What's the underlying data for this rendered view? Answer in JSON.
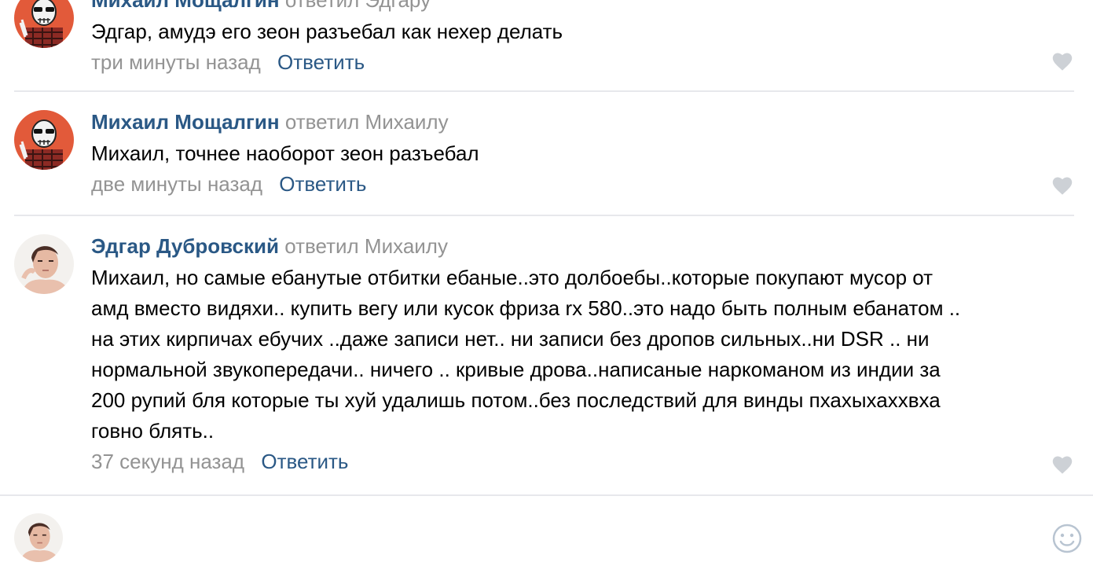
{
  "comments": [
    {
      "author": "Михаил Мощалгин",
      "replied": "ответил Эдгару",
      "text": "Эдгар, амудэ его зеон разъебал как нехер делать",
      "time": "три минуты назад",
      "reply_label": "Ответить"
    },
    {
      "author": "Михаил Мощалгин",
      "replied": "ответил Михаилу",
      "text": "Михаил, точнее наоборот зеон разъебал",
      "time": "две минуты назад",
      "reply_label": "Ответить"
    },
    {
      "author": "Эдгар Дубровский",
      "replied": "ответил Михаилу",
      "text_lines": [
        "Михаил, но самые ебанутые отбитки ебаные..это долбоебы..которые покупают мусор от",
        "амд вместо видяхи.. купить вегу или кусок фриза rx 580..это надо быть полным ебанатом ..",
        "на этих кирпичах ебучих ..даже записи нет.. ни записи без дропов сильных..ни DSR .. ни",
        "нормальной звукопередачи.. ничего .. кривые дрова..написаные наркоманом из индии за",
        "200 рупий бля которые ты хуй удалишь потом..без последствий для винды пхахыхаххвха",
        "говно блять.."
      ],
      "time": "37 секунд назад",
      "reply_label": "Ответить"
    }
  ],
  "icons": {
    "like": "heart-icon",
    "emoji": "smile-icon"
  },
  "colors": {
    "author": "#2a5885",
    "muted": "#939393",
    "like": "#cdd1d6",
    "divider": "#e7e8ec",
    "avatar_skull_bg": "#e25a3a"
  }
}
